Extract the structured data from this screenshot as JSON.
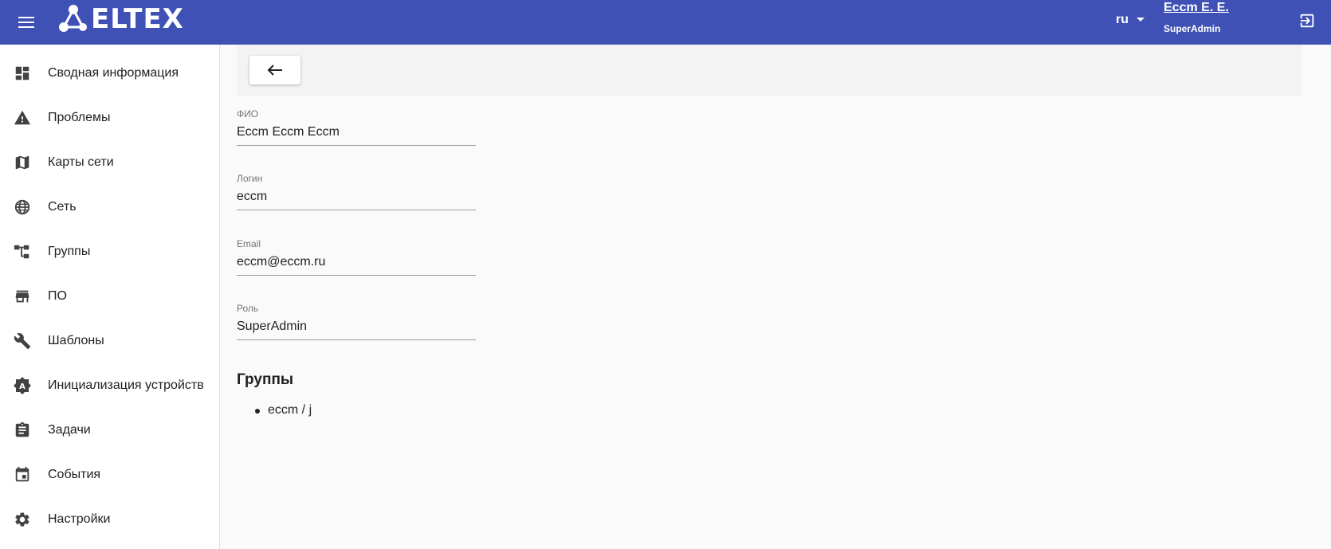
{
  "header": {
    "brand": "ELTEX",
    "language": "ru",
    "user_name": "Eccm E. E.",
    "user_role": "SuperAdmin",
    "accent_color": "#3f51b5"
  },
  "sidebar": {
    "items": [
      {
        "label": "Сводная информация",
        "icon": "dashboard-icon"
      },
      {
        "label": "Проблемы",
        "icon": "warning-icon"
      },
      {
        "label": "Карты сети",
        "icon": "map-icon"
      },
      {
        "label": "Сеть",
        "icon": "globe-icon"
      },
      {
        "label": "Группы",
        "icon": "tree-icon"
      },
      {
        "label": "ПО",
        "icon": "store-icon"
      },
      {
        "label": "Шаблоны",
        "icon": "wrench-icon"
      },
      {
        "label": "Инициализация устройств",
        "icon": "auto-badge-icon"
      },
      {
        "label": "Задачи",
        "icon": "clipboard-icon"
      },
      {
        "label": "События",
        "icon": "calendar-icon"
      },
      {
        "label": "Настройки",
        "icon": "gear-icon"
      }
    ]
  },
  "form": {
    "fio": {
      "label": "ФИО",
      "value": "Eccm Eccm Eccm"
    },
    "login": {
      "label": "Логин",
      "value": "eccm"
    },
    "email": {
      "label": "Email",
      "value": "eccm@eccm.ru"
    },
    "role": {
      "label": "Роль",
      "value": "SuperAdmin"
    }
  },
  "groups": {
    "title": "Группы",
    "items": [
      "eccm / j"
    ]
  }
}
